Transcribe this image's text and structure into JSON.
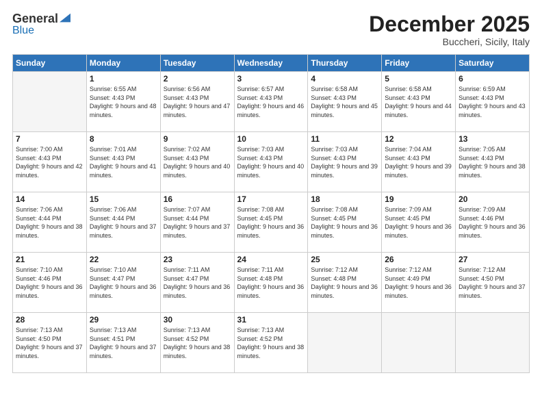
{
  "header": {
    "logo_general": "General",
    "logo_blue": "Blue",
    "month_title": "December 2025",
    "subtitle": "Buccheri, Sicily, Italy"
  },
  "days_of_week": [
    "Sunday",
    "Monday",
    "Tuesday",
    "Wednesday",
    "Thursday",
    "Friday",
    "Saturday"
  ],
  "weeks": [
    [
      {
        "day": "",
        "empty": true
      },
      {
        "day": "1",
        "sunrise": "6:55 AM",
        "sunset": "4:43 PM",
        "daylight": "9 hours and 48 minutes."
      },
      {
        "day": "2",
        "sunrise": "6:56 AM",
        "sunset": "4:43 PM",
        "daylight": "9 hours and 47 minutes."
      },
      {
        "day": "3",
        "sunrise": "6:57 AM",
        "sunset": "4:43 PM",
        "daylight": "9 hours and 46 minutes."
      },
      {
        "day": "4",
        "sunrise": "6:58 AM",
        "sunset": "4:43 PM",
        "daylight": "9 hours and 45 minutes."
      },
      {
        "day": "5",
        "sunrise": "6:58 AM",
        "sunset": "4:43 PM",
        "daylight": "9 hours and 44 minutes."
      },
      {
        "day": "6",
        "sunrise": "6:59 AM",
        "sunset": "4:43 PM",
        "daylight": "9 hours and 43 minutes."
      }
    ],
    [
      {
        "day": "7",
        "sunrise": "7:00 AM",
        "sunset": "4:43 PM",
        "daylight": "9 hours and 42 minutes."
      },
      {
        "day": "8",
        "sunrise": "7:01 AM",
        "sunset": "4:43 PM",
        "daylight": "9 hours and 41 minutes."
      },
      {
        "day": "9",
        "sunrise": "7:02 AM",
        "sunset": "4:43 PM",
        "daylight": "9 hours and 40 minutes."
      },
      {
        "day": "10",
        "sunrise": "7:03 AM",
        "sunset": "4:43 PM",
        "daylight": "9 hours and 40 minutes."
      },
      {
        "day": "11",
        "sunrise": "7:03 AM",
        "sunset": "4:43 PM",
        "daylight": "9 hours and 39 minutes."
      },
      {
        "day": "12",
        "sunrise": "7:04 AM",
        "sunset": "4:43 PM",
        "daylight": "9 hours and 39 minutes."
      },
      {
        "day": "13",
        "sunrise": "7:05 AM",
        "sunset": "4:43 PM",
        "daylight": "9 hours and 38 minutes."
      }
    ],
    [
      {
        "day": "14",
        "sunrise": "7:06 AM",
        "sunset": "4:44 PM",
        "daylight": "9 hours and 38 minutes."
      },
      {
        "day": "15",
        "sunrise": "7:06 AM",
        "sunset": "4:44 PM",
        "daylight": "9 hours and 37 minutes."
      },
      {
        "day": "16",
        "sunrise": "7:07 AM",
        "sunset": "4:44 PM",
        "daylight": "9 hours and 37 minutes."
      },
      {
        "day": "17",
        "sunrise": "7:08 AM",
        "sunset": "4:45 PM",
        "daylight": "9 hours and 36 minutes."
      },
      {
        "day": "18",
        "sunrise": "7:08 AM",
        "sunset": "4:45 PM",
        "daylight": "9 hours and 36 minutes."
      },
      {
        "day": "19",
        "sunrise": "7:09 AM",
        "sunset": "4:45 PM",
        "daylight": "9 hours and 36 minutes."
      },
      {
        "day": "20",
        "sunrise": "7:09 AM",
        "sunset": "4:46 PM",
        "daylight": "9 hours and 36 minutes."
      }
    ],
    [
      {
        "day": "21",
        "sunrise": "7:10 AM",
        "sunset": "4:46 PM",
        "daylight": "9 hours and 36 minutes."
      },
      {
        "day": "22",
        "sunrise": "7:10 AM",
        "sunset": "4:47 PM",
        "daylight": "9 hours and 36 minutes."
      },
      {
        "day": "23",
        "sunrise": "7:11 AM",
        "sunset": "4:47 PM",
        "daylight": "9 hours and 36 minutes."
      },
      {
        "day": "24",
        "sunrise": "7:11 AM",
        "sunset": "4:48 PM",
        "daylight": "9 hours and 36 minutes."
      },
      {
        "day": "25",
        "sunrise": "7:12 AM",
        "sunset": "4:48 PM",
        "daylight": "9 hours and 36 minutes."
      },
      {
        "day": "26",
        "sunrise": "7:12 AM",
        "sunset": "4:49 PM",
        "daylight": "9 hours and 36 minutes."
      },
      {
        "day": "27",
        "sunrise": "7:12 AM",
        "sunset": "4:50 PM",
        "daylight": "9 hours and 37 minutes."
      }
    ],
    [
      {
        "day": "28",
        "sunrise": "7:13 AM",
        "sunset": "4:50 PM",
        "daylight": "9 hours and 37 minutes."
      },
      {
        "day": "29",
        "sunrise": "7:13 AM",
        "sunset": "4:51 PM",
        "daylight": "9 hours and 37 minutes."
      },
      {
        "day": "30",
        "sunrise": "7:13 AM",
        "sunset": "4:52 PM",
        "daylight": "9 hours and 38 minutes."
      },
      {
        "day": "31",
        "sunrise": "7:13 AM",
        "sunset": "4:52 PM",
        "daylight": "9 hours and 38 minutes."
      },
      {
        "day": "",
        "empty": true
      },
      {
        "day": "",
        "empty": true
      },
      {
        "day": "",
        "empty": true
      }
    ]
  ],
  "labels": {
    "sunrise_prefix": "Sunrise: ",
    "sunset_prefix": "Sunset: ",
    "daylight_prefix": "Daylight: "
  }
}
